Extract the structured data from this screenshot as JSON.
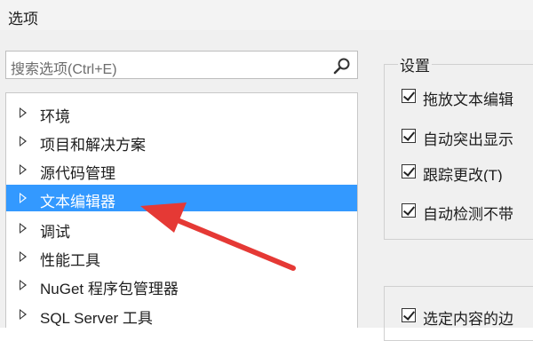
{
  "window": {
    "title": "选项"
  },
  "search": {
    "placeholder": "搜索选项(Ctrl+E)"
  },
  "tree": {
    "items": [
      {
        "label": "环境",
        "selected": false
      },
      {
        "label": "项目和解决方案",
        "selected": false
      },
      {
        "label": "源代码管理",
        "selected": false
      },
      {
        "label": "文本编辑器",
        "selected": true
      },
      {
        "label": "调试",
        "selected": false
      },
      {
        "label": "性能工具",
        "selected": false
      },
      {
        "label": "NuGet 程序包管理器",
        "selected": false
      },
      {
        "label": "SQL Server 工具",
        "selected": false
      }
    ]
  },
  "settings": {
    "title": "设置",
    "options": [
      {
        "label": "拖放文本编辑",
        "checked": true
      },
      {
        "label": "自动突出显示",
        "checked": true
      },
      {
        "label": "跟踪更改(T)",
        "checked": true
      },
      {
        "label": "自动检测不带",
        "checked": true
      },
      {
        "label": "选定内容的边",
        "checked": true
      }
    ]
  },
  "annotation": {
    "color": "#e53935"
  },
  "colors": {
    "selection": "#3399ff"
  }
}
